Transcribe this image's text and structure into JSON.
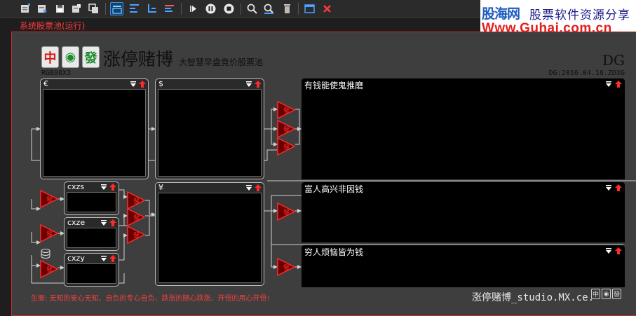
{
  "toolbar": {
    "buttons": [
      {
        "name": "new-doc-icon"
      },
      {
        "name": "open-doc-icon"
      },
      {
        "name": "save-icon"
      },
      {
        "name": "edit-doc-icon"
      },
      {
        "name": "copy-icon"
      },
      {
        "name": "layout-single-icon"
      },
      {
        "name": "align-top-icon"
      },
      {
        "name": "align-bottom-icon"
      },
      {
        "name": "align-left-icon"
      },
      {
        "name": "play-icon"
      },
      {
        "name": "pause-icon"
      },
      {
        "name": "stop-icon"
      },
      {
        "name": "find-icon"
      },
      {
        "name": "find-next-icon"
      },
      {
        "name": "delete-icon"
      },
      {
        "name": "window-icon"
      },
      {
        "name": "close-icon"
      }
    ]
  },
  "banner": {
    "site_name": "股海网",
    "slogan": "股票软件资源分享",
    "url": "Www.Guhai.com.cn"
  },
  "panel_title": "系统股票池(运行)",
  "header": {
    "tiles": [
      "中",
      "◉",
      "發"
    ],
    "title": "涨停赌博",
    "subtitle": "大智慧早盘竞价股票池",
    "code": "RGB98X3",
    "dg_mark": "DG",
    "version": "DG:2016.04.16.ZDXG"
  },
  "blocks": {
    "euro": "€",
    "dollar": "$",
    "yen": "¥",
    "cxzs": "cxzs",
    "cxze": "cxze",
    "cxzy": "cxzy"
  },
  "results": {
    "top": "有钱能使鬼推磨",
    "mid": "富人高兴非因钱",
    "bot": "穷人烦恼皆为钱"
  },
  "triangle_glyph": "發",
  "footer": {
    "motto": "生衡: 无知的安心无知、自负的专心自负、跌涨的随心跌涨、开悟的用心开悟!",
    "brand": "涨停赌博_studio.MX.ce.",
    "mini_tiles": [
      "中",
      "◉",
      "發"
    ]
  },
  "colors": {
    "accent_red": "#ff3b3b",
    "banner_blue": "#1d5bbf",
    "banner_red": "#e01e1e",
    "tile_green": "#1a8c2a"
  }
}
